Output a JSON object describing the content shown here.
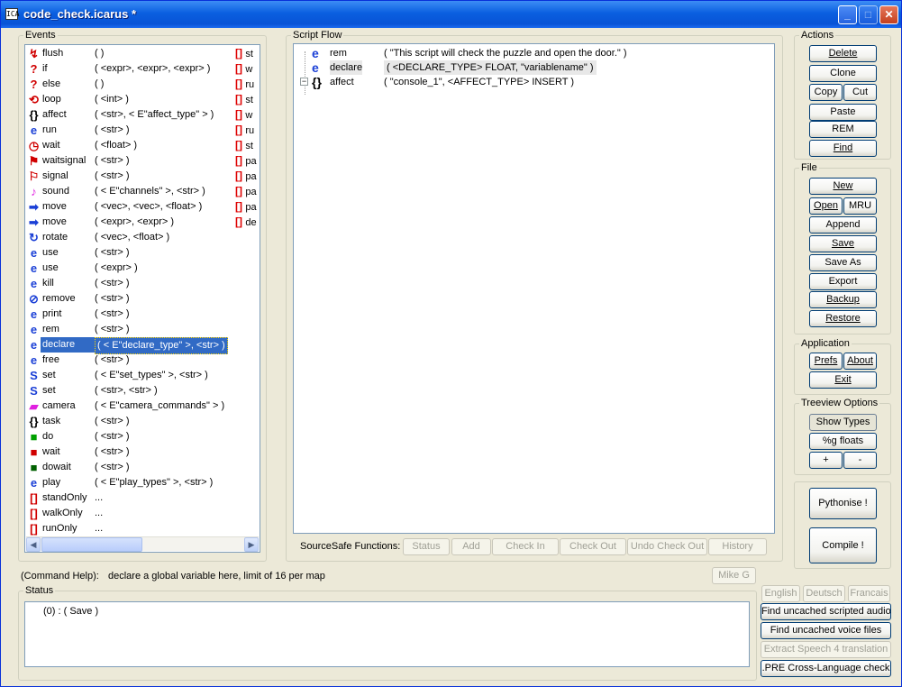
{
  "window": {
    "title": "code_check.icarus *",
    "app_icon_text": "ICA",
    "minimize": "_",
    "maximize": "□",
    "close": "✕"
  },
  "events": {
    "legend": "Events",
    "rows": [
      {
        "icon": "↯",
        "color": "#d00000",
        "name": "flush",
        "params": "(  )"
      },
      {
        "icon": "?",
        "color": "#d00000",
        "name": "if",
        "params": "( <expr>, <expr>, <expr> )"
      },
      {
        "icon": "?",
        "color": "#d00000",
        "name": "else",
        "params": "(  )"
      },
      {
        "icon": "⟲",
        "color": "#d00000",
        "name": "loop",
        "params": "( <int> )"
      },
      {
        "icon": "{}",
        "color": "#000000",
        "name": "affect",
        "params": "( <str>, < E\"affect_type\" > )"
      },
      {
        "icon": "e",
        "color": "#1a3fd6",
        "name": "run",
        "params": "( <str> )"
      },
      {
        "icon": "◷",
        "color": "#d00000",
        "name": "wait",
        "params": "( <float> )"
      },
      {
        "icon": "⚑",
        "color": "#d00000",
        "name": "waitsignal",
        "params": "( <str> )"
      },
      {
        "icon": "⚐",
        "color": "#d00000",
        "name": "signal",
        "params": "( <str> )"
      },
      {
        "icon": "♪",
        "color": "#e020e0",
        "name": "sound",
        "params": "( < E\"channels\" >, <str> )"
      },
      {
        "icon": "➡",
        "color": "#1a3fd6",
        "name": "move",
        "params": "( <vec>, <vec>, <float> )"
      },
      {
        "icon": "➡",
        "color": "#1a3fd6",
        "name": "move",
        "params": "( <expr>, <expr> )"
      },
      {
        "icon": "↻",
        "color": "#1a3fd6",
        "name": "rotate",
        "params": "( <vec>, <float> )"
      },
      {
        "icon": "e",
        "color": "#1a3fd6",
        "name": "use",
        "params": "( <str> )"
      },
      {
        "icon": "e",
        "color": "#1a3fd6",
        "name": "use",
        "params": "( <expr> )"
      },
      {
        "icon": "e",
        "color": "#1a3fd6",
        "name": "kill",
        "params": "( <str> )"
      },
      {
        "icon": "⊘",
        "color": "#1a3fd6",
        "name": "remove",
        "params": "( <str> )"
      },
      {
        "icon": "e",
        "color": "#1a3fd6",
        "name": "print",
        "params": "( <str> )"
      },
      {
        "icon": "e",
        "color": "#1a3fd6",
        "name": "rem",
        "params": "( <str> )"
      },
      {
        "icon": "e",
        "color": "#1a3fd6",
        "name": "declare",
        "params": "( < E\"declare_type\" >, <str> )"
      },
      {
        "icon": "e",
        "color": "#1a3fd6",
        "name": "free",
        "params": "( <str> )"
      },
      {
        "icon": "S",
        "color": "#1a3fd6",
        "name": "set",
        "params": "( < E\"set_types\" >, <str> )"
      },
      {
        "icon": "S",
        "color": "#1a3fd6",
        "name": "set",
        "params": "( <str>, <str> )"
      },
      {
        "icon": "▰",
        "color": "#e020e0",
        "name": "camera",
        "params": "( < E\"camera_commands\" > )"
      },
      {
        "icon": "{}",
        "color": "#000000",
        "name": "task",
        "params": "( <str> )"
      },
      {
        "icon": "■",
        "color": "#00a000",
        "name": "do",
        "params": "( <str> )"
      },
      {
        "icon": "■",
        "color": "#d00000",
        "name": "wait",
        "params": "( <str> )"
      },
      {
        "icon": "■",
        "color": "#006000",
        "name": "dowait",
        "params": "( <str> )"
      },
      {
        "icon": "e",
        "color": "#1a3fd6",
        "name": "play",
        "params": "( < E\"play_types\" >, <str> )"
      },
      {
        "icon": "[]",
        "color": "#d00000",
        "name": "standOnly",
        "params": "..."
      },
      {
        "icon": "[]",
        "color": "#d00000",
        "name": "walkOnly",
        "params": "..."
      },
      {
        "icon": "[]",
        "color": "#d00000",
        "name": "runOnly",
        "params": "..."
      }
    ],
    "selected_index": 19,
    "right_column": [
      "st",
      "w",
      "ru",
      "st",
      "w",
      "ru",
      "st",
      "pa",
      "pa",
      "pa",
      "pa",
      "de"
    ]
  },
  "script_flow": {
    "legend": "Script Flow",
    "rows": [
      {
        "icon": "e",
        "name": "rem",
        "params": "( \"This script will check the puzzle and open the door.\" )",
        "selected": false
      },
      {
        "icon": "e",
        "name": "declare",
        "params": "( <DECLARE_TYPE> FLOAT, \"variablename\" )",
        "selected": true
      },
      {
        "icon": "{}",
        "name": "affect",
        "params": "( \"console_1\", <AFFECT_TYPE> INSERT )",
        "selected": false
      }
    ],
    "expander": "−",
    "sourcesafe_label": "SourceSafe Functions:",
    "sourcesafe_buttons": [
      "Status",
      "Add",
      "Check In",
      "Check Out",
      "Undo Check Out",
      "History"
    ]
  },
  "actions": {
    "legend": "Actions",
    "delete": "Delete",
    "clone": "Clone",
    "copy": "Copy",
    "cut": "Cut",
    "paste": "Paste",
    "rem": "REM",
    "find": "Find"
  },
  "file": {
    "legend": "File",
    "new": "New",
    "open": "Open",
    "mru": "MRU",
    "append": "Append",
    "save": "Save",
    "save_as": "Save As",
    "export": "Export",
    "backup": "Backup",
    "restore": "Restore"
  },
  "application": {
    "legend": "Application",
    "prefs": "Prefs",
    "about": "About",
    "exit": "Exit"
  },
  "treeview": {
    "legend": "Treeview Options",
    "show_types": "Show Types",
    "g_floats": "%g floats",
    "plus": "+",
    "minus": "-"
  },
  "big_buttons": {
    "pythonise": "Pythonise !",
    "compile": "Compile !"
  },
  "command_help": {
    "label": "(Command Help):",
    "text": "declare a global variable here, limit of 16 per map",
    "author": "Mike G"
  },
  "status": {
    "legend": "Status",
    "line": "(0) : ( Save )"
  },
  "language": {
    "english": "English",
    "deutsch": "Deutsch",
    "francais": "Francais"
  },
  "tools": {
    "audio": "Find uncached scripted audio",
    "voice": "Find uncached voice files",
    "speech": "Extract Speech 4 translation",
    "pre": ".PRE Cross-Language check"
  }
}
